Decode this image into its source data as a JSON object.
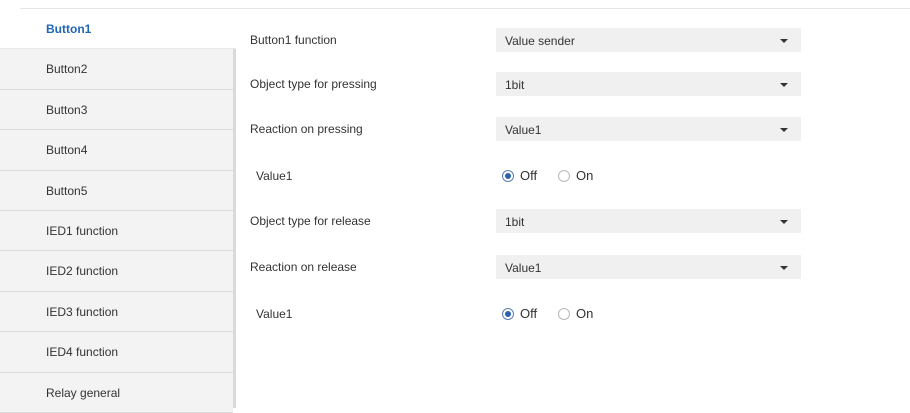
{
  "sidebar": {
    "items": [
      {
        "label": "Button1",
        "active": true
      },
      {
        "label": "Button2"
      },
      {
        "label": "Button3"
      },
      {
        "label": "Button4"
      },
      {
        "label": "Button5"
      },
      {
        "label": "IED1 function"
      },
      {
        "label": "IED2 function"
      },
      {
        "label": "IED3 function"
      },
      {
        "label": "IED4 function"
      },
      {
        "label": "Relay general"
      }
    ]
  },
  "form": {
    "button1_function": {
      "label": "Button1 function",
      "value": "Value sender"
    },
    "object_type_pressing": {
      "label": "Object type for pressing",
      "value": "1bit"
    },
    "reaction_pressing": {
      "label": "Reaction on pressing",
      "value": "Value1"
    },
    "value1_pressing": {
      "label": "Value1",
      "options": [
        "Off",
        "On"
      ],
      "selected": "Off"
    },
    "object_type_release": {
      "label": "Object type for release",
      "value": "1bit"
    },
    "reaction_release": {
      "label": "Reaction on release",
      "value": "Value1"
    },
    "value1_release": {
      "label": "Value1",
      "options": [
        "Off",
        "On"
      ],
      "selected": "Off"
    }
  },
  "colors": {
    "active_text": "#1f65b8",
    "sidebar_bg": "#f3f3f3",
    "dropdown_bg": "#f0f0f0",
    "radio_checked": "#2c62b0"
  }
}
